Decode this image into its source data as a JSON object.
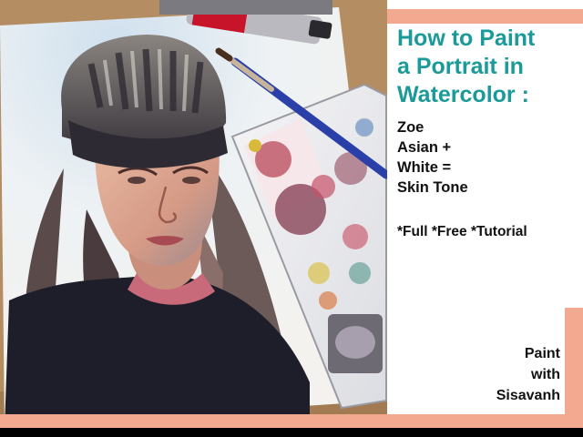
{
  "title_lines": [
    "How to Paint",
    "a Portrait in",
    "Watercolor :"
  ],
  "subtitle_lines": [
    "Zoe",
    "Asian +",
    "White =",
    "Skin Tone"
  ],
  "tagline": "*Full *Free *Tutorial",
  "credit_lines": [
    "Paint",
    "with",
    "Sisavanh"
  ],
  "colors": {
    "title_teal": "#1a9a98",
    "accent_salmon": "#f2a990",
    "panel_background": "#ffffff",
    "text_dark": "#111111"
  }
}
